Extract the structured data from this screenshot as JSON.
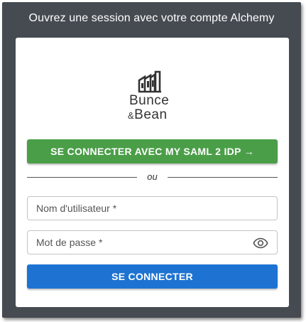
{
  "header": {
    "title": "Ouvrez une session avec votre compte Alchemy"
  },
  "logo": {
    "line1": "Bunce",
    "amp": "&",
    "line2": "Bean"
  },
  "saml_button": {
    "label": "SE CONNECTER AVEC MY SAML 2 IDP →"
  },
  "divider": {
    "text": "ou"
  },
  "username": {
    "placeholder": "Nom d'utilisateur *",
    "value": ""
  },
  "password": {
    "placeholder": "Mot de passe *",
    "value": "",
    "toggle_icon": "eye-icon"
  },
  "login_button": {
    "label": "SE CONNECTER"
  },
  "colors": {
    "background": "#464b52",
    "saml": "#4b9e48",
    "login": "#1e73d2"
  }
}
